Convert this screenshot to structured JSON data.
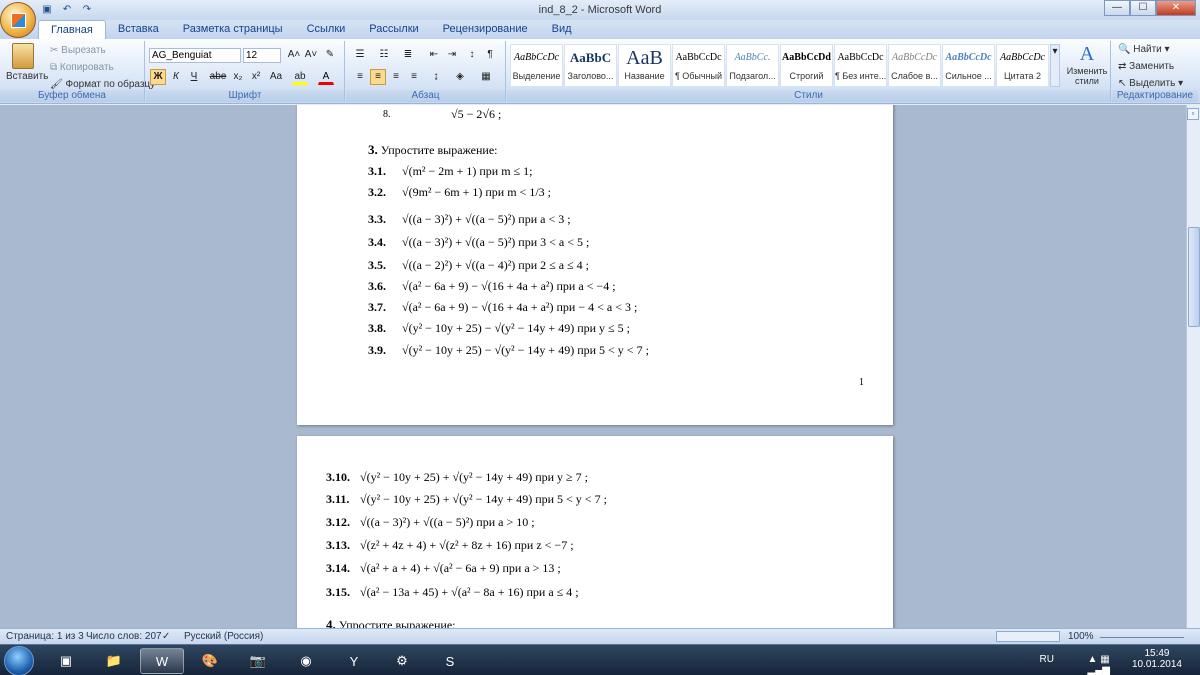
{
  "window": {
    "title": "ind_8_2 - Microsoft Word",
    "min": "—",
    "max": "☐",
    "close": "✕",
    "qat_undo": "↶",
    "qat_redo": "↷"
  },
  "tabs": [
    "Главная",
    "Вставка",
    "Разметка страницы",
    "Ссылки",
    "Рассылки",
    "Рецензирование",
    "Вид"
  ],
  "clipboard": {
    "paste": "Вставить",
    "cut": "Вырезать",
    "copy": "Копировать",
    "format": "Формат по образцу",
    "label": "Буфер обмена"
  },
  "font": {
    "name": "AG_Benguiat",
    "size": "12",
    "label": "Шрифт",
    "bold": "Ж",
    "italic": "К",
    "underline": "Ч",
    "strike": "abe",
    "sub": "x₂",
    "sup": "x²",
    "case": "Aa"
  },
  "paragraph": {
    "label": "Абзац"
  },
  "styles": {
    "label": "Стили",
    "change": "Изменить стили",
    "items": [
      {
        "preview": "AaBbCcDc",
        "name": "Выделение"
      },
      {
        "preview": "AaBbC",
        "name": "Заголово..."
      },
      {
        "preview": "AaB",
        "name": "Название"
      },
      {
        "preview": "AaBbCcDc",
        "name": "¶ Обычный"
      },
      {
        "preview": "AaBbCc.",
        "name": "Подзагол..."
      },
      {
        "preview": "AaBbCcDd",
        "name": "Строгий"
      },
      {
        "preview": "AaBbCcDc",
        "name": "¶ Без инте..."
      },
      {
        "preview": "AaBbCcDc",
        "name": "Слабое в..."
      },
      {
        "preview": "AaBbCcDc",
        "name": "Сильное ..."
      },
      {
        "preview": "AaBbCcDc",
        "name": "Цитата 2"
      }
    ]
  },
  "editing": {
    "find": "Найти",
    "replace": "Заменить",
    "select": "Выделить",
    "label": "Редактирование"
  },
  "page1": {
    "top_line": {
      "num": "8.",
      "expr": "√5 − 2√6 ;"
    },
    "heading": {
      "num": "3.",
      "text": "Упростите выражение:"
    },
    "items": [
      {
        "n": "3.1.",
        "e": "√(m² − 2m + 1)  при  m ≤ 1;"
      },
      {
        "n": "3.2.",
        "e": "√(9m² − 6m + 1)  при  m < 1/3 ;"
      },
      {
        "n": "3.3.",
        "e": "√((a − 3)²) + √((a − 5)²)  при  a < 3 ;"
      },
      {
        "n": "3.4.",
        "e": "√((a − 3)²) + √((a − 5)²)  при  3 < a < 5 ;"
      },
      {
        "n": "3.5.",
        "e": "√((a − 2)²) + √((a − 4)²)  при 2 ≤ a ≤ 4 ;"
      },
      {
        "n": "3.6.",
        "e": "√(a² − 6a + 9) − √(16 + 4a + a²)  при  a < −4 ;"
      },
      {
        "n": "3.7.",
        "e": "√(a² − 6a + 9) − √(16 + 4a + a²)  при  − 4 < a < 3 ;"
      },
      {
        "n": "3.8.",
        "e": "√(y² − 10y + 25) − √(y² − 14y + 49)  при  y ≤ 5 ;"
      },
      {
        "n": "3.9.",
        "e": "√(y² − 10y + 25) − √(y² − 14y + 49)  при 5 < y < 7 ;"
      }
    ],
    "page_number": "1"
  },
  "page2": {
    "items": [
      {
        "n": "3.10.",
        "e": "√(y² − 10y + 25) + √(y² − 14y + 49)  при  y ≥ 7 ;"
      },
      {
        "n": "3.11.",
        "e": "√(y² − 10y + 25) + √(y² − 14y + 49)  при  5 < y < 7 ;"
      },
      {
        "n": "3.12.",
        "e": "√((a − 3)²) + √((a − 5)²)  при  a > 10 ;"
      },
      {
        "n": "3.13.",
        "e": "√(z² + 4z + 4) + √(z² + 8z + 16)  при  z < −7 ;"
      },
      {
        "n": "3.14.",
        "e": "√(a² + a + 4) + √(a² − 6a + 9)  при  a > 13 ;"
      },
      {
        "n": "3.15.",
        "e": "√(a² − 13a + 45) + √(a² − 8a + 16)  при  a ≤ 4 ;"
      }
    ],
    "heading": {
      "num": "4.",
      "text": "Упростите выражение:"
    }
  },
  "status": {
    "page": "Страница: 1 из 3",
    "words": "Число слов: 207",
    "lang": "Русский (Россия)",
    "zoom": "100%"
  },
  "tray": {
    "lang": "RU",
    "time": "15:49",
    "date": "10.01.2014"
  }
}
